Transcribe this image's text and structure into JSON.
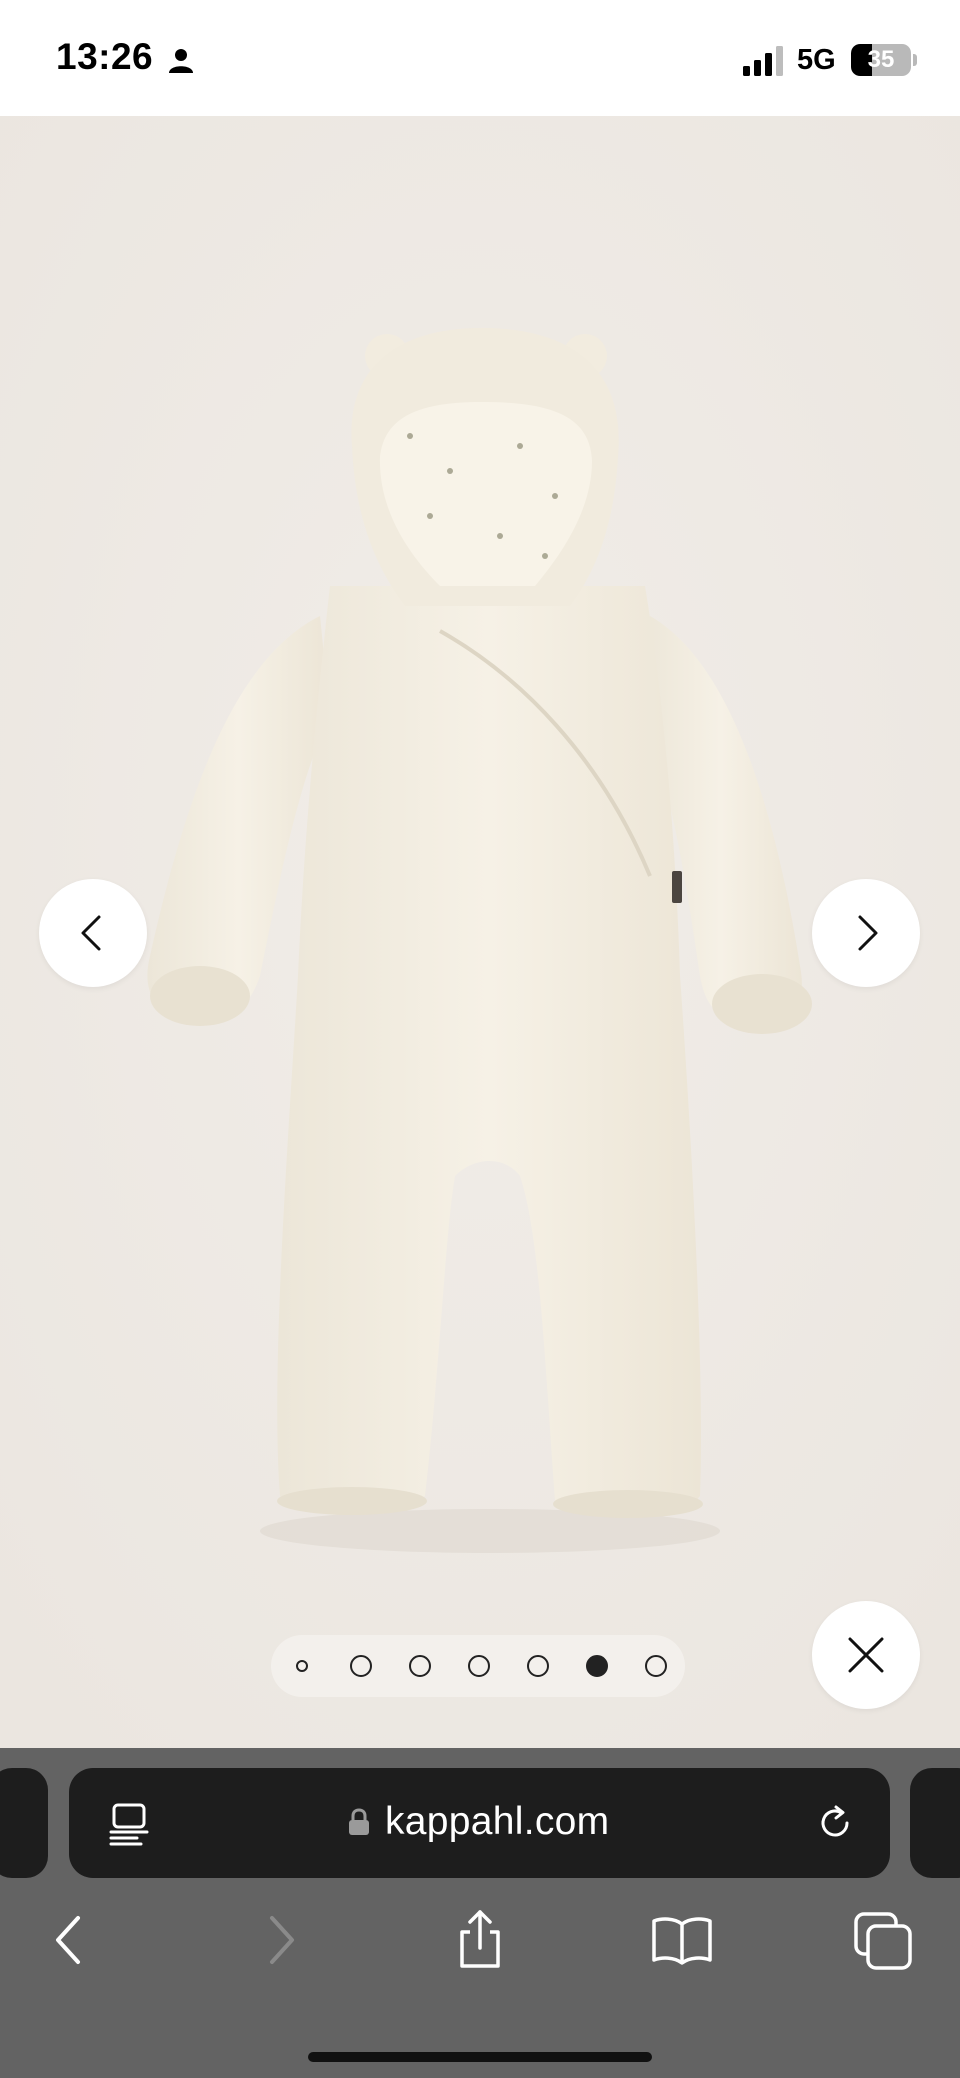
{
  "status_bar": {
    "time": "13:26",
    "network": "5G",
    "battery_percent": "35",
    "battery_level": 0.35,
    "signal_bars": 3
  },
  "gallery": {
    "image_subject": "cream hooded baby overall with bear ears",
    "dot_count": 7,
    "active_dot": 5,
    "icons": {
      "prev": "chevron-left-icon",
      "next": "chevron-right-icon",
      "close": "close-icon"
    }
  },
  "browser": {
    "url": "kappahl.com",
    "icons": {
      "page_menu": "page-menu-icon",
      "lock": "lock-icon",
      "reload": "reload-icon"
    },
    "toolbar": [
      "back-icon",
      "forward-icon",
      "share-icon",
      "bookmarks-icon",
      "tabs-icon"
    ]
  },
  "colors": {
    "gallery_bg": "#eeeae5",
    "garment": "#f3eee3",
    "browser_chrome": "#636363",
    "address_bar": "#1d1d1d"
  }
}
